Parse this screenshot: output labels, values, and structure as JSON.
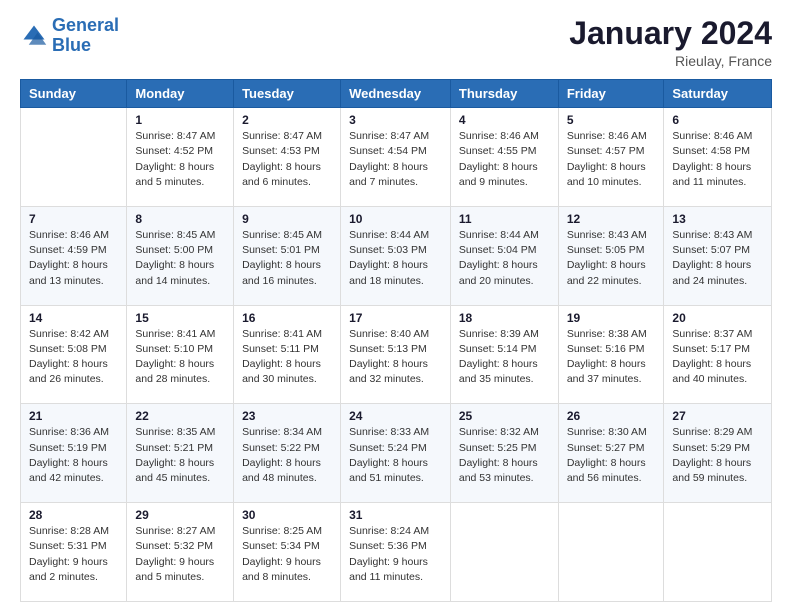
{
  "logo": {
    "line1": "General",
    "line2": "Blue"
  },
  "title": "January 2024",
  "location": "Rieulay, France",
  "header": {
    "days": [
      "Sunday",
      "Monday",
      "Tuesday",
      "Wednesday",
      "Thursday",
      "Friday",
      "Saturday"
    ]
  },
  "weeks": [
    [
      {
        "day": "",
        "sunrise": "",
        "sunset": "",
        "daylight": ""
      },
      {
        "day": "1",
        "sunrise": "Sunrise: 8:47 AM",
        "sunset": "Sunset: 4:52 PM",
        "daylight": "Daylight: 8 hours and 5 minutes."
      },
      {
        "day": "2",
        "sunrise": "Sunrise: 8:47 AM",
        "sunset": "Sunset: 4:53 PM",
        "daylight": "Daylight: 8 hours and 6 minutes."
      },
      {
        "day": "3",
        "sunrise": "Sunrise: 8:47 AM",
        "sunset": "Sunset: 4:54 PM",
        "daylight": "Daylight: 8 hours and 7 minutes."
      },
      {
        "day": "4",
        "sunrise": "Sunrise: 8:46 AM",
        "sunset": "Sunset: 4:55 PM",
        "daylight": "Daylight: 8 hours and 9 minutes."
      },
      {
        "day": "5",
        "sunrise": "Sunrise: 8:46 AM",
        "sunset": "Sunset: 4:57 PM",
        "daylight": "Daylight: 8 hours and 10 minutes."
      },
      {
        "day": "6",
        "sunrise": "Sunrise: 8:46 AM",
        "sunset": "Sunset: 4:58 PM",
        "daylight": "Daylight: 8 hours and 11 minutes."
      }
    ],
    [
      {
        "day": "7",
        "sunrise": "Sunrise: 8:46 AM",
        "sunset": "Sunset: 4:59 PM",
        "daylight": "Daylight: 8 hours and 13 minutes."
      },
      {
        "day": "8",
        "sunrise": "Sunrise: 8:45 AM",
        "sunset": "Sunset: 5:00 PM",
        "daylight": "Daylight: 8 hours and 14 minutes."
      },
      {
        "day": "9",
        "sunrise": "Sunrise: 8:45 AM",
        "sunset": "Sunset: 5:01 PM",
        "daylight": "Daylight: 8 hours and 16 minutes."
      },
      {
        "day": "10",
        "sunrise": "Sunrise: 8:44 AM",
        "sunset": "Sunset: 5:03 PM",
        "daylight": "Daylight: 8 hours and 18 minutes."
      },
      {
        "day": "11",
        "sunrise": "Sunrise: 8:44 AM",
        "sunset": "Sunset: 5:04 PM",
        "daylight": "Daylight: 8 hours and 20 minutes."
      },
      {
        "day": "12",
        "sunrise": "Sunrise: 8:43 AM",
        "sunset": "Sunset: 5:05 PM",
        "daylight": "Daylight: 8 hours and 22 minutes."
      },
      {
        "day": "13",
        "sunrise": "Sunrise: 8:43 AM",
        "sunset": "Sunset: 5:07 PM",
        "daylight": "Daylight: 8 hours and 24 minutes."
      }
    ],
    [
      {
        "day": "14",
        "sunrise": "Sunrise: 8:42 AM",
        "sunset": "Sunset: 5:08 PM",
        "daylight": "Daylight: 8 hours and 26 minutes."
      },
      {
        "day": "15",
        "sunrise": "Sunrise: 8:41 AM",
        "sunset": "Sunset: 5:10 PM",
        "daylight": "Daylight: 8 hours and 28 minutes."
      },
      {
        "day": "16",
        "sunrise": "Sunrise: 8:41 AM",
        "sunset": "Sunset: 5:11 PM",
        "daylight": "Daylight: 8 hours and 30 minutes."
      },
      {
        "day": "17",
        "sunrise": "Sunrise: 8:40 AM",
        "sunset": "Sunset: 5:13 PM",
        "daylight": "Daylight: 8 hours and 32 minutes."
      },
      {
        "day": "18",
        "sunrise": "Sunrise: 8:39 AM",
        "sunset": "Sunset: 5:14 PM",
        "daylight": "Daylight: 8 hours and 35 minutes."
      },
      {
        "day": "19",
        "sunrise": "Sunrise: 8:38 AM",
        "sunset": "Sunset: 5:16 PM",
        "daylight": "Daylight: 8 hours and 37 minutes."
      },
      {
        "day": "20",
        "sunrise": "Sunrise: 8:37 AM",
        "sunset": "Sunset: 5:17 PM",
        "daylight": "Daylight: 8 hours and 40 minutes."
      }
    ],
    [
      {
        "day": "21",
        "sunrise": "Sunrise: 8:36 AM",
        "sunset": "Sunset: 5:19 PM",
        "daylight": "Daylight: 8 hours and 42 minutes."
      },
      {
        "day": "22",
        "sunrise": "Sunrise: 8:35 AM",
        "sunset": "Sunset: 5:21 PM",
        "daylight": "Daylight: 8 hours and 45 minutes."
      },
      {
        "day": "23",
        "sunrise": "Sunrise: 8:34 AM",
        "sunset": "Sunset: 5:22 PM",
        "daylight": "Daylight: 8 hours and 48 minutes."
      },
      {
        "day": "24",
        "sunrise": "Sunrise: 8:33 AM",
        "sunset": "Sunset: 5:24 PM",
        "daylight": "Daylight: 8 hours and 51 minutes."
      },
      {
        "day": "25",
        "sunrise": "Sunrise: 8:32 AM",
        "sunset": "Sunset: 5:25 PM",
        "daylight": "Daylight: 8 hours and 53 minutes."
      },
      {
        "day": "26",
        "sunrise": "Sunrise: 8:30 AM",
        "sunset": "Sunset: 5:27 PM",
        "daylight": "Daylight: 8 hours and 56 minutes."
      },
      {
        "day": "27",
        "sunrise": "Sunrise: 8:29 AM",
        "sunset": "Sunset: 5:29 PM",
        "daylight": "Daylight: 8 hours and 59 minutes."
      }
    ],
    [
      {
        "day": "28",
        "sunrise": "Sunrise: 8:28 AM",
        "sunset": "Sunset: 5:31 PM",
        "daylight": "Daylight: 9 hours and 2 minutes."
      },
      {
        "day": "29",
        "sunrise": "Sunrise: 8:27 AM",
        "sunset": "Sunset: 5:32 PM",
        "daylight": "Daylight: 9 hours and 5 minutes."
      },
      {
        "day": "30",
        "sunrise": "Sunrise: 8:25 AM",
        "sunset": "Sunset: 5:34 PM",
        "daylight": "Daylight: 9 hours and 8 minutes."
      },
      {
        "day": "31",
        "sunrise": "Sunrise: 8:24 AM",
        "sunset": "Sunset: 5:36 PM",
        "daylight": "Daylight: 9 hours and 11 minutes."
      },
      {
        "day": "",
        "sunrise": "",
        "sunset": "",
        "daylight": ""
      },
      {
        "day": "",
        "sunrise": "",
        "sunset": "",
        "daylight": ""
      },
      {
        "day": "",
        "sunrise": "",
        "sunset": "",
        "daylight": ""
      }
    ]
  ]
}
